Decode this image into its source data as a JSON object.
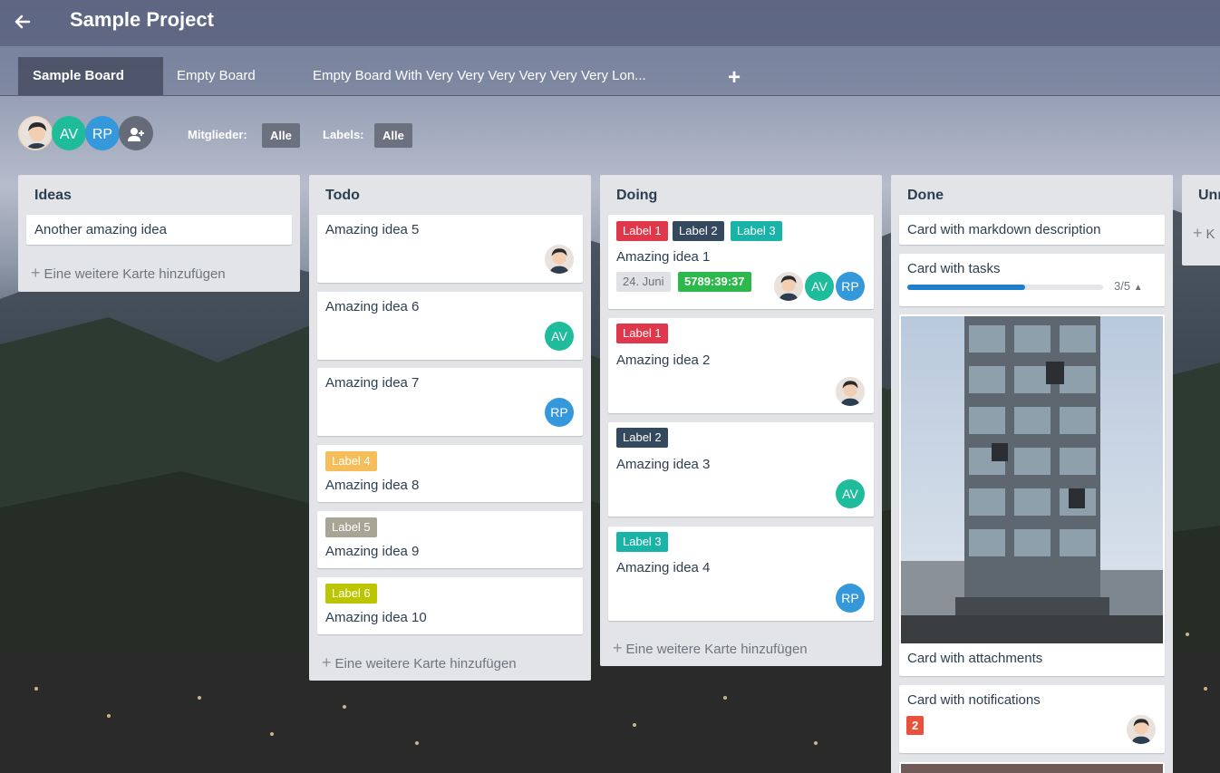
{
  "header": {
    "project_title": "Sample Project"
  },
  "tabs": [
    {
      "label": "Sample Board",
      "active": true
    },
    {
      "label": "Empty Board",
      "active": false
    },
    {
      "label": "Empty Board With Very Very Very Very Very Very Lon...",
      "active": false
    }
  ],
  "filter": {
    "members": [
      {
        "initials": "",
        "type": "photo"
      },
      {
        "initials": "AV",
        "color": "#1fbc9c"
      },
      {
        "initials": "RP",
        "color": "#3498db"
      }
    ],
    "members_label": "Mitglieder:",
    "members_value": "Alle",
    "labels_label": "Labels:",
    "labels_value": "Alle"
  },
  "add_card_label": "Eine weitere Karte hinzufügen",
  "lists": [
    {
      "title": "Ideas",
      "cards": [
        {
          "title": "Another amazing idea"
        }
      ]
    },
    {
      "title": "Todo",
      "cards": [
        {
          "title": "Amazing idea 5",
          "member": "photo"
        },
        {
          "title": "Amazing idea 6",
          "member": "AV"
        },
        {
          "title": "Amazing idea 7",
          "member": "RP"
        },
        {
          "title": "Amazing idea 8",
          "labels": [
            "Label 4"
          ]
        },
        {
          "title": "Amazing idea 9",
          "labels": [
            "Label 5"
          ]
        },
        {
          "title": "Amazing idea 10",
          "labels": [
            "Label 6"
          ]
        }
      ]
    },
    {
      "title": "Doing",
      "cards": [
        {
          "title": "Amazing idea 1",
          "labels": [
            "Label 1",
            "Label 2",
            "Label 3"
          ],
          "due": "24. Juni",
          "timer": "5789:39:37",
          "members": [
            "photo",
            "AV",
            "RP"
          ]
        },
        {
          "title": "Amazing idea 2",
          "labels": [
            "Label 1"
          ],
          "member": "photo"
        },
        {
          "title": "Amazing idea 3",
          "labels": [
            "Label 2"
          ],
          "member": "AV"
        },
        {
          "title": "Amazing idea 4",
          "labels": [
            "Label 3"
          ],
          "member": "RP"
        }
      ]
    },
    {
      "title": "Done",
      "cards": [
        {
          "title": "Card with markdown description"
        },
        {
          "title": "Card with tasks",
          "tasks_done": 3,
          "tasks_total": 5,
          "tasks_count": "3/5"
        },
        {
          "title": "Card with attachments"
        },
        {
          "title": "Card with notifications",
          "notifications": "2",
          "member": "photo"
        }
      ]
    },
    {
      "title": "Unr",
      "add_fragment": "K"
    }
  ],
  "label_colors": {
    "Label 1": "#e0374a",
    "Label 2": "#34495e",
    "Label 3": "#1ab3a8",
    "Label 4": "#f6be5a",
    "Label 5": "#a8a596",
    "Label 6": "#bcc600"
  },
  "colors": {
    "timer_green": "#2cb84a",
    "due_grey": "#dfe1e5",
    "notification_red": "#e9513d",
    "progress_blue": "#1e7fcf"
  },
  "icons": {
    "back": "arrow-left-icon",
    "add_tab": "plus-icon",
    "add_member": "user-plus-icon",
    "add_card": "plus-icon",
    "task_toggle": "caret-up-icon"
  }
}
